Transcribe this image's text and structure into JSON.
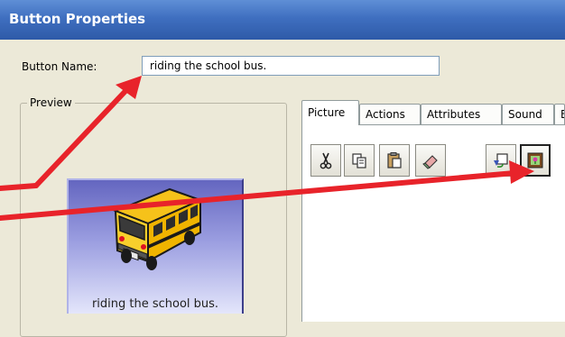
{
  "window": {
    "title": "Button Properties"
  },
  "button_name": {
    "label": "Button Name:",
    "value": "riding the school bus."
  },
  "preview": {
    "legend": "Preview",
    "caption": "riding the school bus."
  },
  "tabs": [
    {
      "label": "Picture",
      "active": true
    },
    {
      "label": "Actions",
      "active": false
    },
    {
      "label": "Attributes",
      "active": false
    },
    {
      "label": "Sound",
      "active": false
    },
    {
      "label": "E",
      "active": false
    }
  ],
  "toolbar": {
    "tools": [
      "scissors-icon",
      "copy-icon",
      "paste-icon",
      "eraser-icon",
      "rotate-icon",
      "picture-frame-icon"
    ]
  },
  "colors": {
    "title_bar": "#2e5aa8",
    "dialog_bg": "#ece9d8",
    "annotation_arrow": "#e8232a",
    "preview_tile_top": "#6466c0"
  }
}
